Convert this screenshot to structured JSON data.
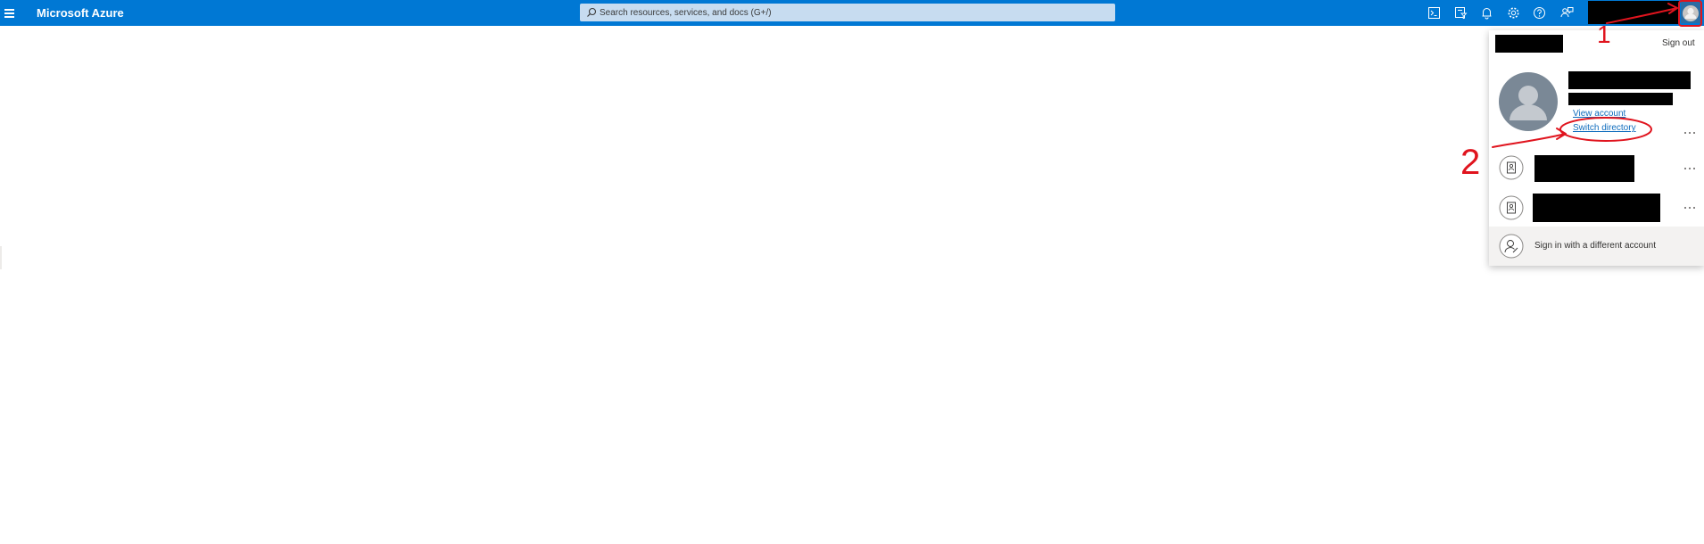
{
  "app": {
    "brand": "Microsoft Azure",
    "accent_color": "#0078d4"
  },
  "search": {
    "placeholder": "Search resources, services, and docs (G+/)",
    "value": ""
  },
  "toolbar": {
    "icons": [
      "cloud-shell-icon",
      "directory-filter-icon",
      "notifications-icon",
      "settings-icon",
      "help-icon",
      "feedback-icon",
      "account-avatar-icon"
    ]
  },
  "account_panel": {
    "sign_out_label": "Sign out",
    "view_account_label": "View account",
    "switch_directory_label": "Switch directory",
    "sign_in_different_label": "Sign in with a different account",
    "directories": [
      {
        "icon": "directory-badge-icon"
      },
      {
        "icon": "directory-badge-icon"
      }
    ]
  },
  "annotations": {
    "step1": "1",
    "step2": "2",
    "color": "#e0141e"
  }
}
